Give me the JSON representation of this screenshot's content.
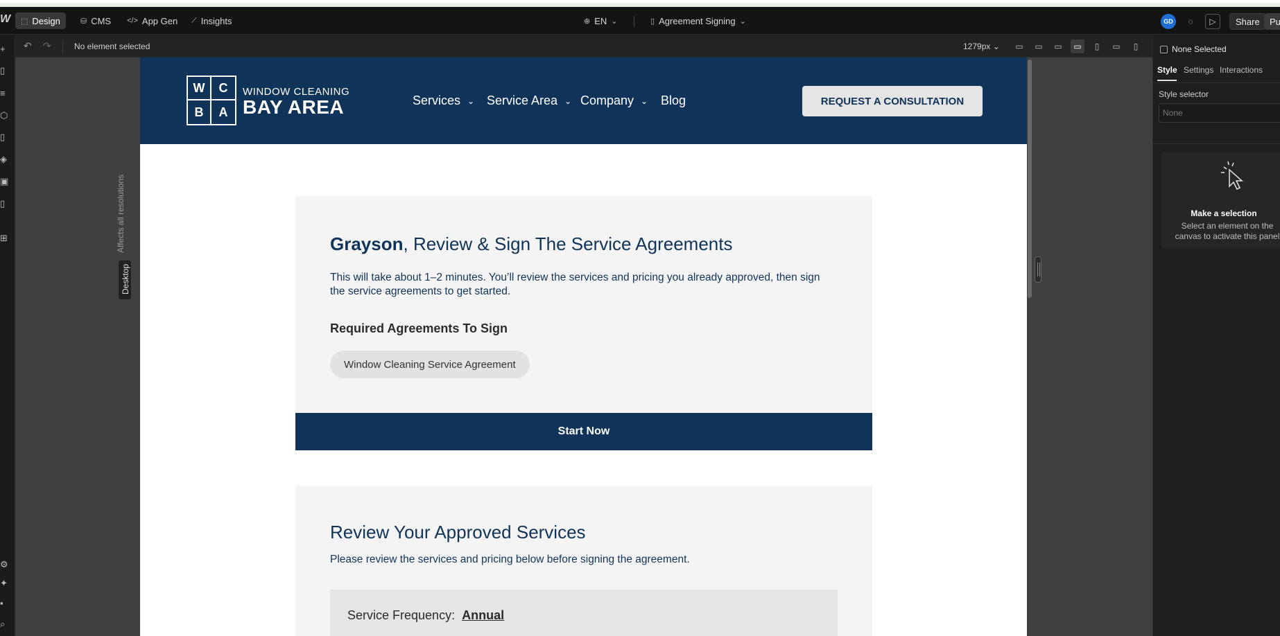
{
  "topbar": {
    "tabs": [
      {
        "label": "Design",
        "icon": "design-icon"
      },
      {
        "label": "CMS",
        "icon": "database-icon"
      },
      {
        "label": "App Gen",
        "icon": "code-icon"
      },
      {
        "label": "Insights",
        "icon": "chart-icon"
      }
    ],
    "locale": "EN",
    "page_name": "Agreement Signing",
    "avatar_initials": "GD",
    "share_label": "Share",
    "publish_label": "Pu"
  },
  "subbar": {
    "status": "No element selected",
    "width_readout": "1279px"
  },
  "canvas": {
    "affects_label": "Affects all resolutions",
    "breakpoint_label": "Desktop"
  },
  "site": {
    "brand": {
      "letters": [
        "W",
        "C",
        "B",
        "A"
      ],
      "subtitle": "WINDOW CLEANING",
      "title": "BAY AREA"
    },
    "nav": [
      {
        "label": "Services",
        "has_menu": true
      },
      {
        "label": "Service Area",
        "has_menu": true
      },
      {
        "label": "Company",
        "has_menu": true
      },
      {
        "label": "Blog",
        "has_menu": false
      }
    ],
    "cta_label": "REQUEST A CONSULTATION",
    "hero": {
      "name": "Grayson",
      "title_rest": ", Review & Sign The Service Agreements",
      "description": "This will take about 1–2 minutes. You’ll review the services and pricing you already approved, then sign the service agreements to get started.",
      "required_heading": "Required Agreements To Sign",
      "agreements": [
        "Window Cleaning Service Agreement"
      ],
      "start_label": "Start Now"
    },
    "review": {
      "title": "Review Your Approved Services",
      "description": "Please review the services and pricing below before signing the agreement.",
      "frequency_label": "Service Frequency:",
      "frequency_value": "Annual"
    }
  },
  "rpanel": {
    "none_selected": "None Selected",
    "tabs": [
      "Style",
      "Settings",
      "Interactions"
    ],
    "style_selector_label": "Style selector",
    "style_selector_placeholder": "None",
    "empty_title": "Make a selection",
    "empty_desc": "Select an element on the canvas to activate this panel"
  },
  "colors": {
    "brand_navy": "#103459",
    "panel_bg": "#1e1e1e",
    "accent_blue": "#1f6ed4"
  }
}
